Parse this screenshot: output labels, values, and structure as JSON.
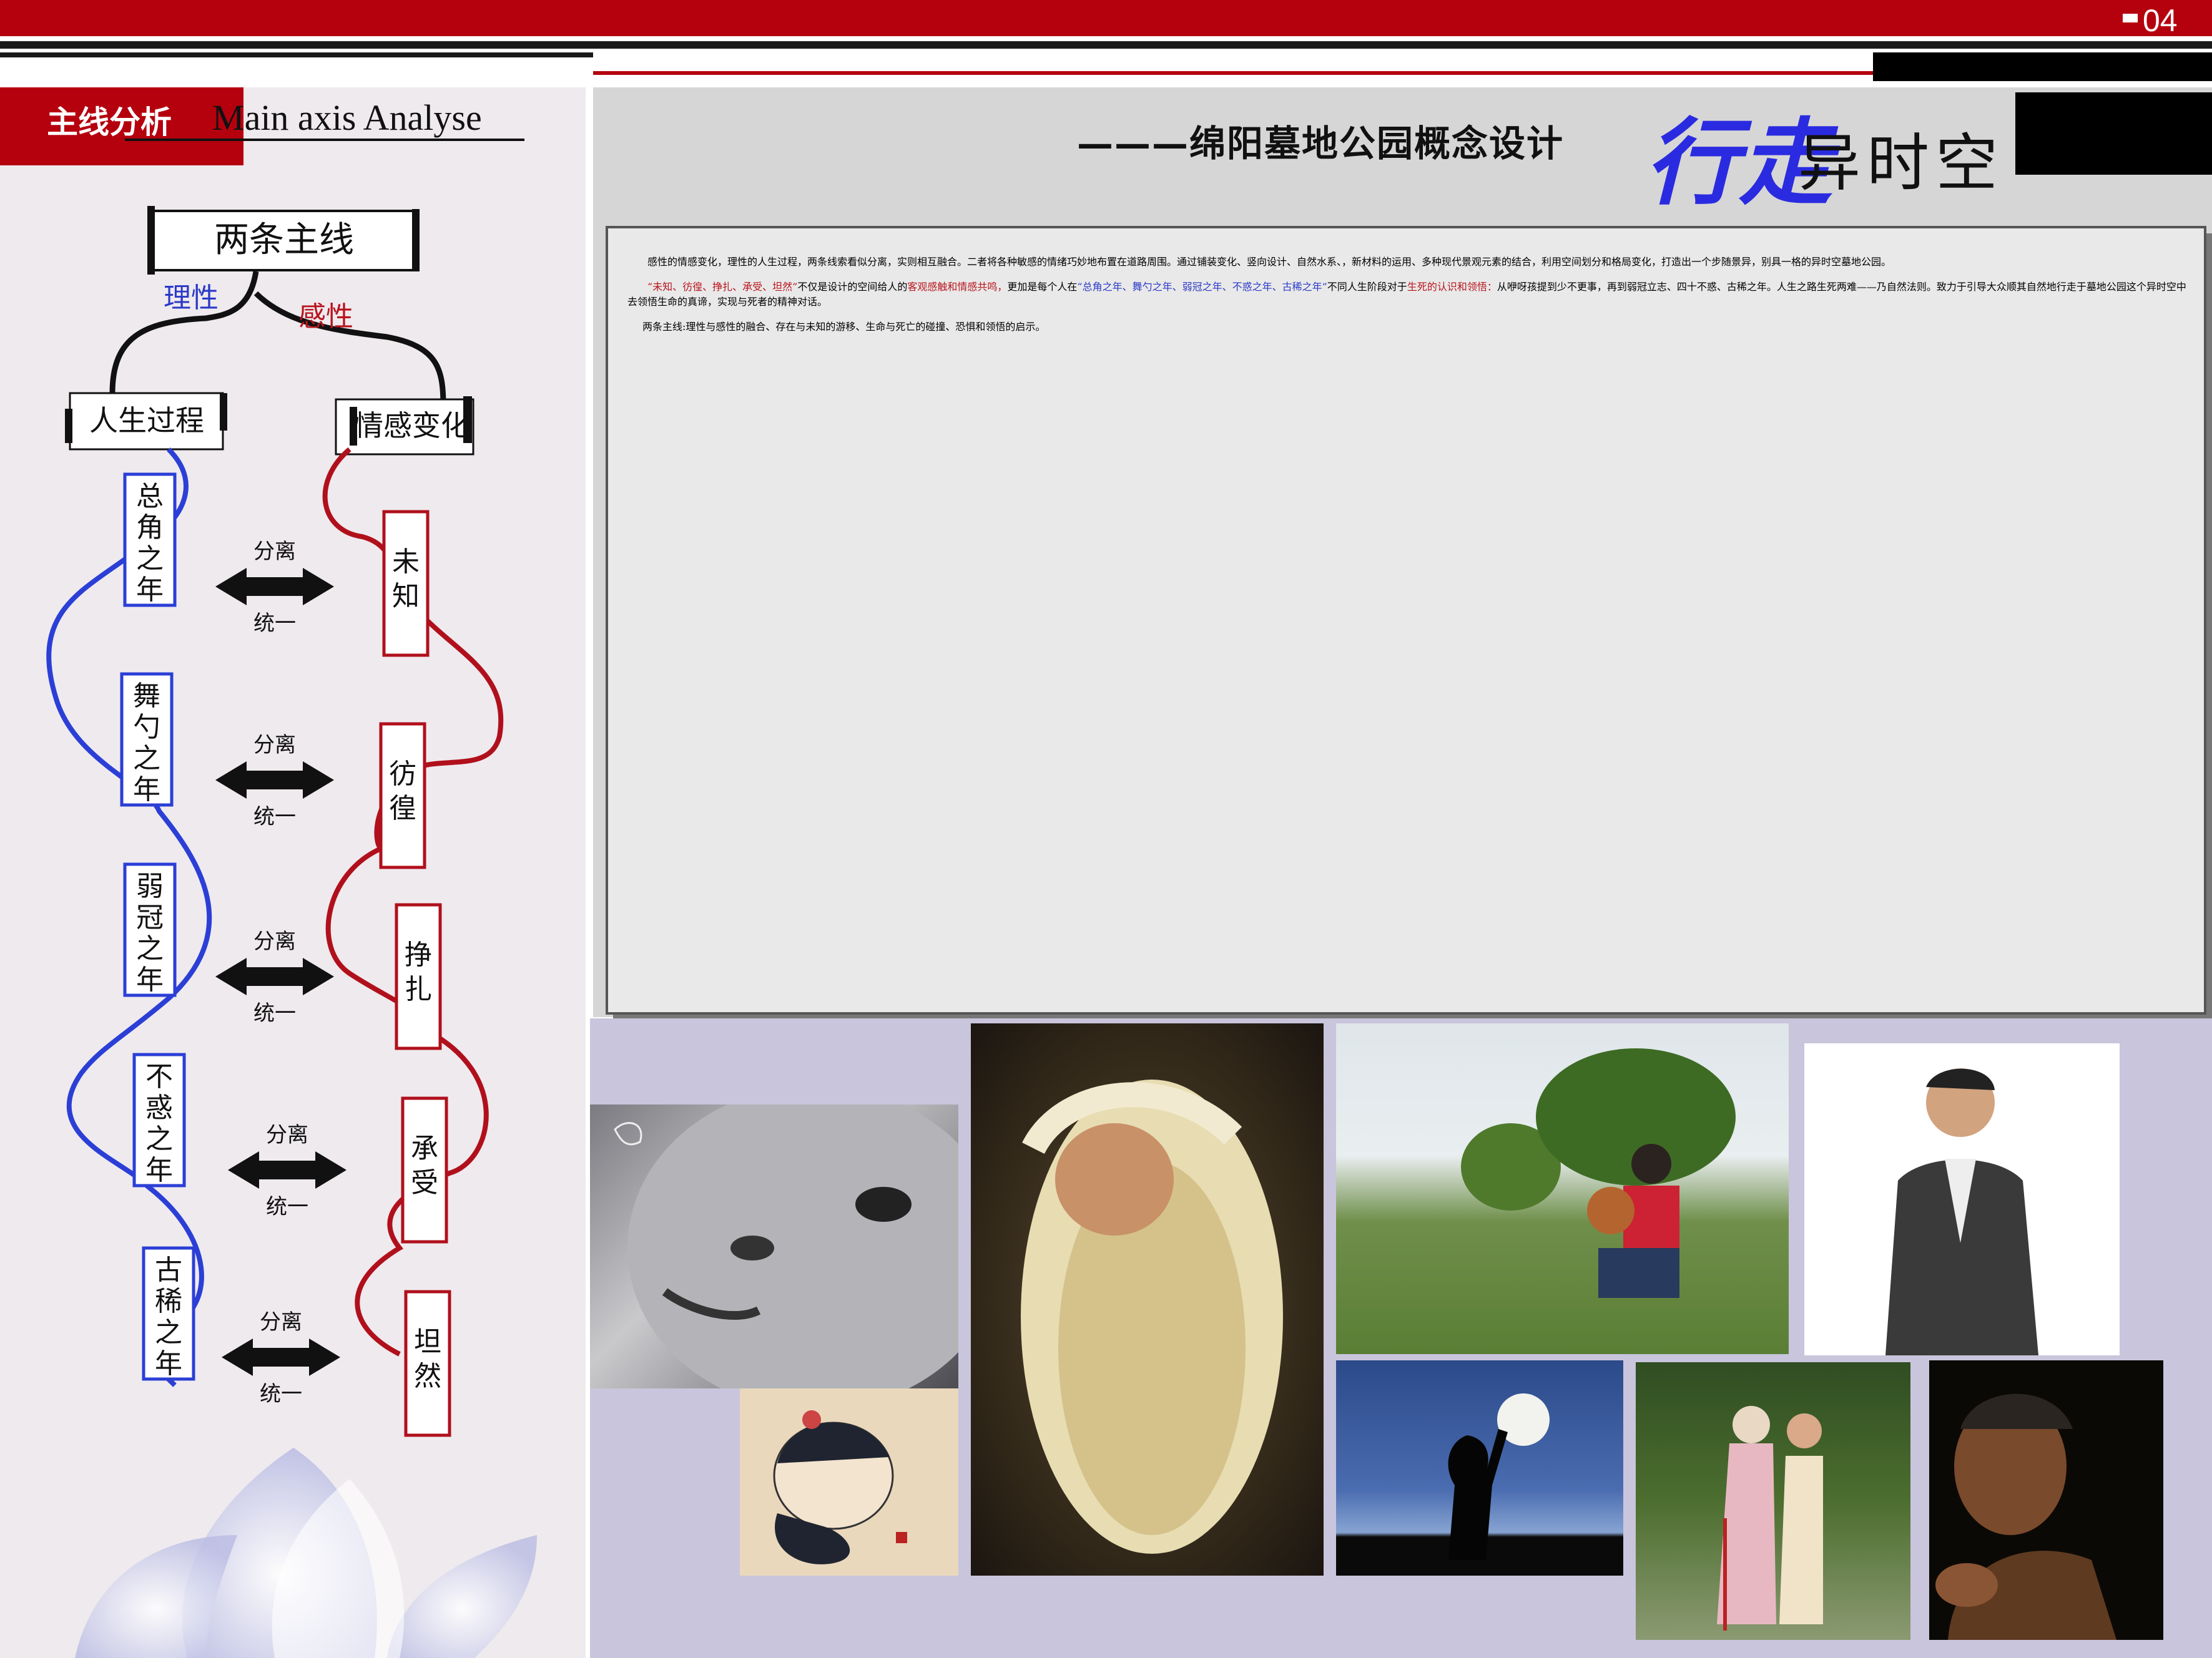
{
  "page": {
    "number": "04",
    "section_title_cn": "主线分析",
    "section_title_en": "Main axis Analyse",
    "subtitle": "———绵阳墓地公园概念设计",
    "logo_main": "行走",
    "logo_rest": "异时空"
  },
  "diagram": {
    "root": "两条主线",
    "branch_left_label": "理性",
    "branch_right_label": "感性",
    "left_title": "人生过程",
    "right_title": "情感变化",
    "left_nodes": [
      "总角之年",
      "舞勺之年",
      "弱冠之年",
      "不惑之年",
      "古稀之年"
    ],
    "right_nodes": [
      "未知",
      "彷徨",
      "挣扎",
      "承受",
      "坦然"
    ],
    "arrow_top": "分离",
    "arrow_bottom": "统一",
    "colors": {
      "left": "#2b3fd6",
      "right": "#b0101c",
      "accent": "#b5000e"
    }
  },
  "text": {
    "p1": "感性的情感变化，理性的人生过程，两条线索看似分离，实则相互融合。二者将各种敏感的情绪巧妙地布置在道路周围。通过铺装变化、竖向设计、自然水系、，新材料的运用、多种现代景观元素的结合，利用空间划分和格局变化，打造出一个步随景异，别具一格的异时空墓地公园。",
    "p2_red1": "“未知、彷徨、挣扎、承受、坦然”",
    "p2_a": "不仅是设计的空间给人的",
    "p2_red2": "客观感触和情感共鸣，",
    "p2_b": "更加是每个人在",
    "p2_blue": "“总角之年、舞勺之年、弱冠之年、不惑之年、古稀之年”",
    "p2_c": "不同人生阶段对于",
    "p2_red3": "生死的认识和领悟：",
    "p2_d": "从咿呀孩提到少不更事，再到弱冠立志、四十不惑、古稀之年。人生之路生死两难——乃自然法则。致力于引导大众顺其自然地行走于墓地公园这个异时空中去领悟生命的真谛，实现与死者的精神对话。",
    "p3": "两条主线:理性与感性的融合、存在与未知的游移、生命与死亡的碰撞、恐惧和领悟的启示。"
  }
}
